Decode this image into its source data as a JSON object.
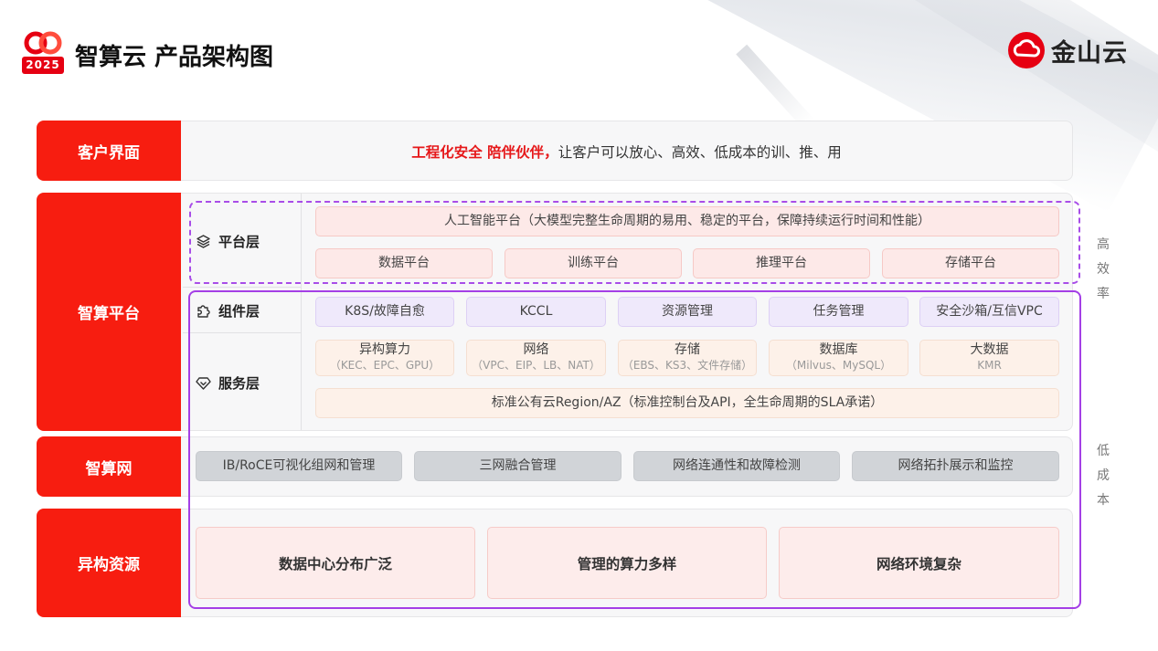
{
  "header": {
    "title": "智算云 产品架构图",
    "logo_year": "2025",
    "brand_name": "金山云"
  },
  "rows": {
    "customer": {
      "label": "客户界面",
      "highlight": "工程化安全 陪伴伙伴，",
      "text": "让客户可以放心、高效、低成本的训、推、用"
    },
    "platform": {
      "label": "智算平台",
      "platform_layer": {
        "name": "平台层",
        "top_box": "人工智能平台（大模型完整生命周期的易用、稳定的平台，保障持续运行时间和性能）",
        "boxes": [
          "数据平台",
          "训练平台",
          "推理平台",
          "存储平台"
        ]
      },
      "component_layer": {
        "name": "组件层",
        "boxes": [
          "K8S/故障自愈",
          "KCCL",
          "资源管理",
          "任务管理",
          "安全沙箱/互信VPC"
        ]
      },
      "service_layer": {
        "name": "服务层",
        "boxes": [
          {
            "title": "异构算力",
            "sub": "（KEC、EPC、GPU）"
          },
          {
            "title": "网络",
            "sub": "（VPC、EIP、LB、NAT）"
          },
          {
            "title": "存储",
            "sub": "（EBS、KS3、文件存储）"
          },
          {
            "title": "数据库",
            "sub": "（Milvus、MySQL）"
          },
          {
            "title": "大数据",
            "sub": "KMR"
          }
        ],
        "bottom_box": "标准公有云Region/AZ（标准控制台及API，全生命周期的SLA承诺）"
      }
    },
    "network": {
      "label": "智算网",
      "boxes": [
        "IB/RoCE可视化组网和管理",
        "三网融合管理",
        "网络连通性和故障检测",
        "网络拓扑展示和监控"
      ]
    },
    "resources": {
      "label": "异构资源",
      "boxes": [
        "数据中心分布广泛",
        "管理的算力多样",
        "网络环境复杂"
      ]
    }
  },
  "side_labels": {
    "high_efficiency": [
      "高",
      "效",
      "率"
    ],
    "low_cost": [
      "低",
      "成",
      "本"
    ]
  },
  "colors": {
    "brand_red": "#f71d10",
    "purple_frame": "#a43fe6"
  }
}
